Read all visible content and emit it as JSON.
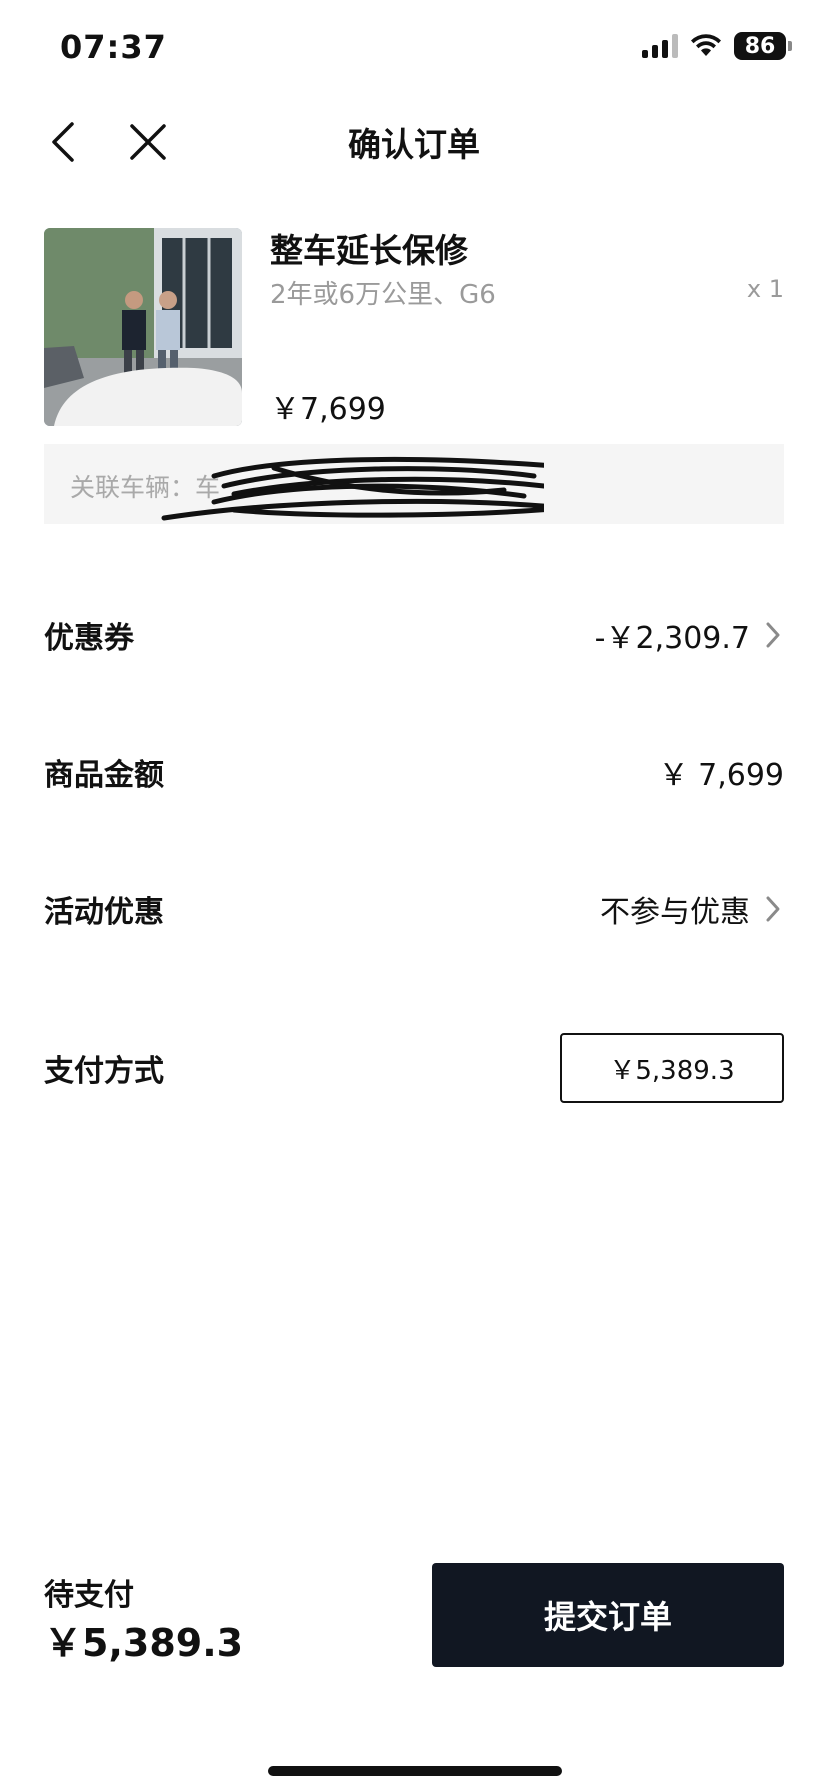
{
  "status_bar": {
    "time": "07:37",
    "battery": "86"
  },
  "nav": {
    "title": "确认订单"
  },
  "product": {
    "name": "整车延长保修",
    "spec": "2年或6万公里、G6",
    "quantity": "x 1",
    "price": "￥7,699",
    "vehicle_label": "关联车辆：车"
  },
  "rows": {
    "coupon": {
      "label": "优惠券",
      "value": "-￥2,309.7"
    },
    "goods_amount": {
      "label": "商品金额",
      "value": "￥ 7,699"
    },
    "promotion": {
      "label": "活动优惠",
      "value": "不参与优惠"
    },
    "payment": {
      "label": "支付方式",
      "value": "￥5,389.3"
    }
  },
  "footer": {
    "pending_label": "待支付",
    "pending_amount": "￥5,389.3",
    "submit_label": "提交订单"
  },
  "icons": {
    "back": "chevron-left-icon",
    "close": "close-icon",
    "arrow": "chevron-right-icon"
  },
  "colors": {
    "button_bg": "#111722",
    "muted_text": "#9a9a9a",
    "vehicle_bg": "#f5f5f5"
  }
}
